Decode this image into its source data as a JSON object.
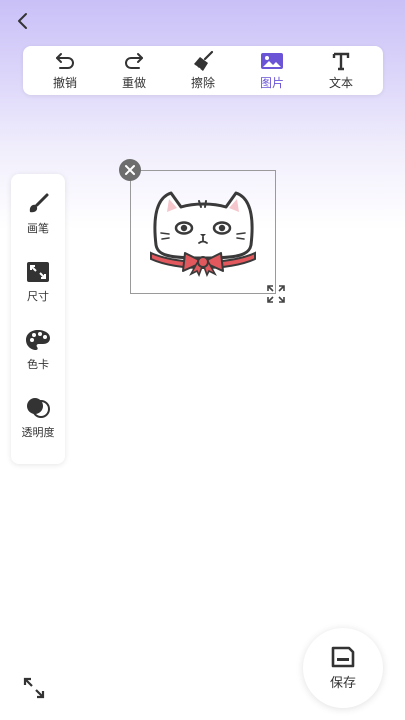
{
  "header": {
    "back_icon": "chevron-left-icon"
  },
  "toolbar": {
    "items": [
      {
        "label": "撤销",
        "icon": "undo-icon"
      },
      {
        "label": "重做",
        "icon": "redo-icon"
      },
      {
        "label": "擦除",
        "icon": "broom-icon"
      },
      {
        "label": "图片",
        "icon": "image-icon",
        "active": true
      },
      {
        "label": "文本",
        "icon": "text-icon"
      }
    ],
    "active_color": "#6b55d6"
  },
  "sidebar": {
    "items": [
      {
        "label": "画笔",
        "icon": "brush-icon"
      },
      {
        "label": "尺寸",
        "icon": "size-icon"
      },
      {
        "label": "色卡",
        "icon": "palette-icon"
      },
      {
        "label": "透明度",
        "icon": "opacity-icon"
      }
    ]
  },
  "canvas": {
    "sticker": "cat-sticker-image",
    "close_icon": "close-icon",
    "resize_icon": "resize-icon"
  },
  "footer": {
    "fullscreen_icon": "expand-icon",
    "save_label": "保存",
    "save_icon": "save-icon"
  }
}
